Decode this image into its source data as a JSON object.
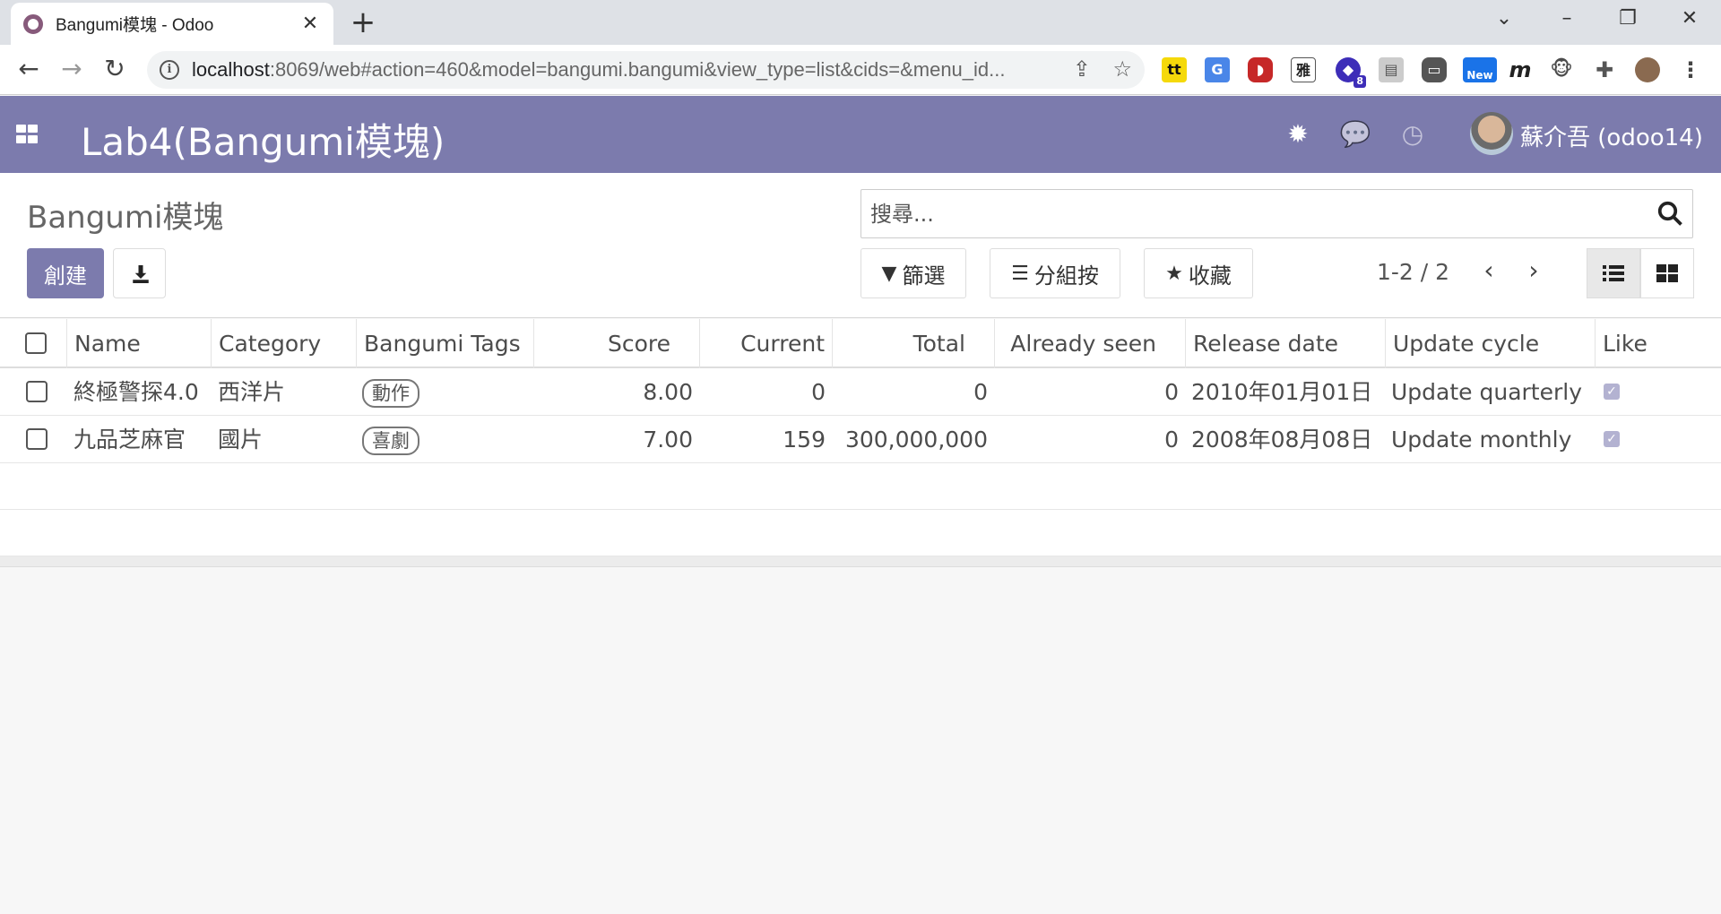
{
  "browser": {
    "tab_title": "Bangumi模塊 - Odoo",
    "url_host": "localhost",
    "url_rest": ":8069/web#action=460&model=bangumi.bangumi&view_type=list&cids=&menu_id...",
    "ext_new_label": "New",
    "ext_badge": "8"
  },
  "navbar": {
    "app_title": "Lab4(Bangumi模塊)",
    "user_name": "蘇介吾 (odoo14)"
  },
  "control_panel": {
    "breadcrumb": "Bangumi模塊",
    "create_label": "創建",
    "search_placeholder": "搜尋...",
    "filter_label": "篩選",
    "groupby_label": "分組按",
    "favorites_label": "收藏",
    "pager": "1-2 / 2"
  },
  "list": {
    "columns": [
      "Name",
      "Category",
      "Bangumi Tags",
      "Score",
      "Current",
      "Total",
      "Already seen",
      "Release date",
      "Update cycle",
      "Like"
    ],
    "rows": [
      {
        "name": "終極警探4.0",
        "category": "西洋片",
        "tag": "動作",
        "score": "8.00",
        "current": "0",
        "total": "0",
        "already_seen": "0",
        "release_date": "2010年01月01日",
        "update_cycle": "Update quarterly",
        "like": true
      },
      {
        "name": "九品芝麻官",
        "category": "國片",
        "tag": "喜劇",
        "score": "7.00",
        "current": "159",
        "total": "300,000,000",
        "already_seen": "0",
        "release_date": "2008年08月08日",
        "update_cycle": "Update monthly",
        "like": true
      }
    ]
  },
  "colors": {
    "odoo_purple": "#7c7bad",
    "tab_favicon": "#875a7b"
  }
}
